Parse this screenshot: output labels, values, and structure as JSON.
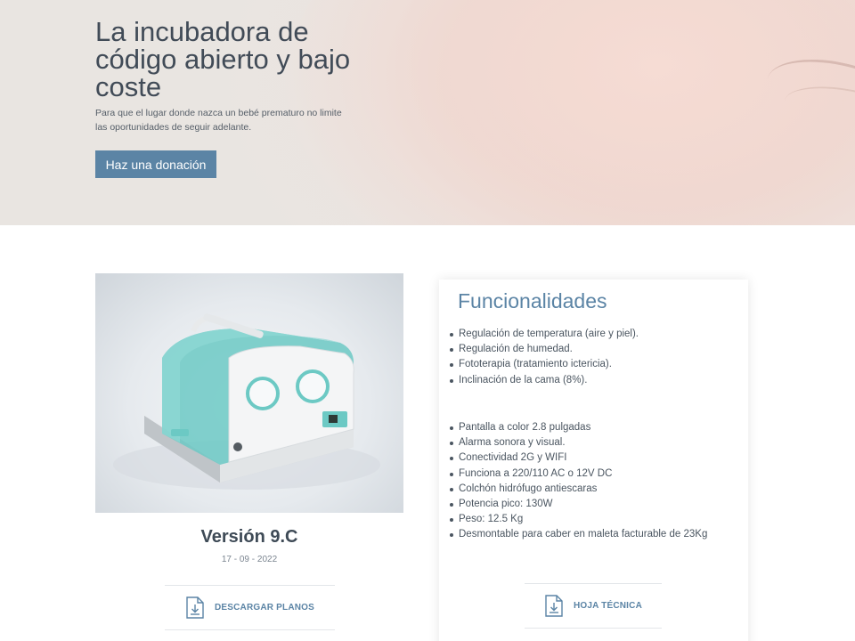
{
  "hero": {
    "title": "La incubadora de código abierto y bajo coste",
    "subtitle": "Para que el lugar donde nazca un bebé prematuro no limite las oportunidades de seguir adelante.",
    "button_label": "Haz una donación"
  },
  "product": {
    "image_icon": "incubator-3d-render",
    "version_title": "Versión 9.C",
    "date": "17 - 09 - 2022",
    "download_label": "DESCARGAR PLANOS",
    "datasheet_label": "HOJA TÉCNICA"
  },
  "features": {
    "title": "Funcionalidades",
    "group1": [
      "Regulación de temperatura (aire y piel).",
      "Regulación de humedad.",
      "Fototerapia (tratamiento ictericia).",
      "Inclinación de la cama (8%)."
    ],
    "group2": [
      "Pantalla a color 2.8 pulgadas",
      "Alarma sonora y visual.",
      "Conectividad 2G y WIFI",
      "Funciona a 220/110 AC o 12V DC",
      "Colchón hidrófugo antiescaras",
      "Potencia pico: 130W",
      "Peso: 12.5 Kg",
      "Desmontable para caber en maleta facturable de 23Kg"
    ]
  },
  "colors": {
    "accent": "#5b84a5",
    "text": "#3e4a56",
    "incubator_teal": "#6cc9c4"
  }
}
